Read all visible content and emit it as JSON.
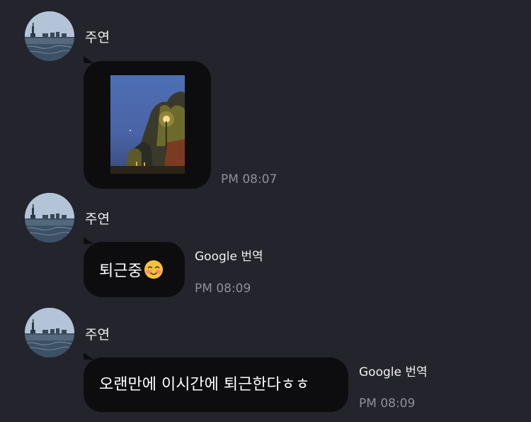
{
  "messages": [
    {
      "sender": "주연",
      "type": "image",
      "timestamp": "PM 08:07"
    },
    {
      "sender": "주연",
      "type": "text",
      "text": "퇴근중",
      "emoji": "smiling-blushing-face",
      "translate_label": "Google 번역",
      "timestamp": "PM 08:09"
    },
    {
      "sender": "주연",
      "type": "text",
      "text": "오랜만에 이시간에 퇴근한다ㅎㅎ",
      "translate_label": "Google 번역",
      "timestamp": "PM 08:09"
    }
  ],
  "colors": {
    "background": "#24242c",
    "bubble": "#0d0d10",
    "timestamp": "#8f8f9c",
    "text": "#ffffff"
  }
}
